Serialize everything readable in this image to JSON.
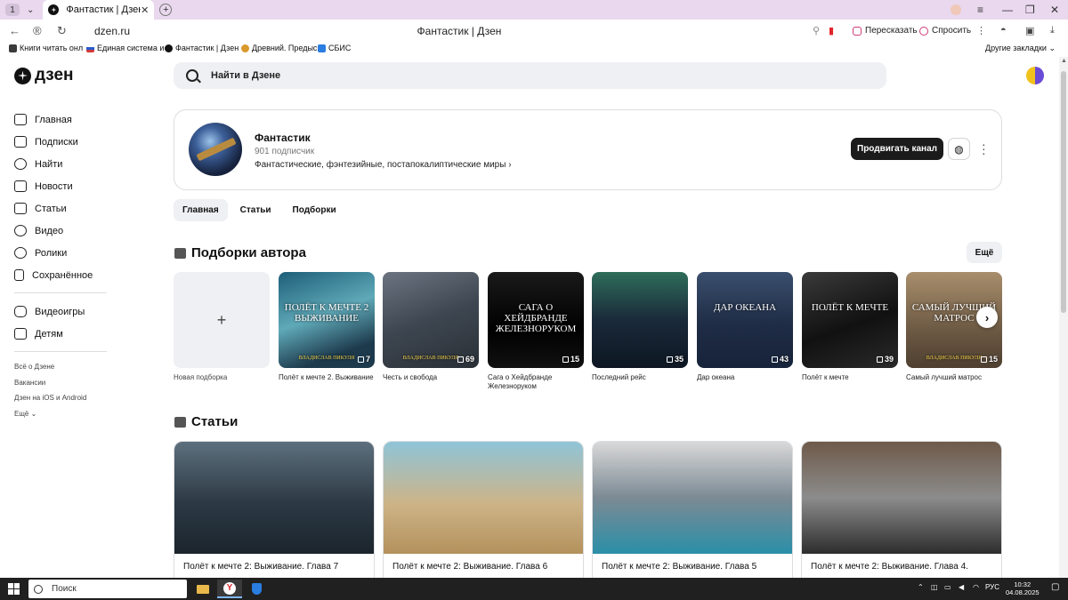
{
  "browser": {
    "tab_counter": "1",
    "tab_title": "Фантастик | Дзен",
    "url": "dzen.ru",
    "page_title": "Фантастик | Дзен",
    "retell_label": "Пересказать",
    "ask_label": "Спросить",
    "bookmarks": [
      {
        "label": "Книги читать онл",
        "color": "#3a3a3a"
      },
      {
        "label": "Единая система и",
        "color": "#d23a3a"
      },
      {
        "label": "Фантастик | Дзен",
        "color": "#111111"
      },
      {
        "label": "Древний. Предыс",
        "color": "#d99a2b"
      },
      {
        "label": "СБИС",
        "color": "#2a7de1"
      }
    ],
    "other_bookmarks": "Другие закладки"
  },
  "logo": {
    "text": "дзен"
  },
  "search": {
    "placeholder": "Найти в Дзене"
  },
  "sidebar": {
    "items": [
      {
        "label": "Главная",
        "icon": "home-icon"
      },
      {
        "label": "Подписки",
        "icon": "subscriptions-icon"
      },
      {
        "label": "Найти",
        "icon": "search-icon"
      },
      {
        "label": "Новости",
        "icon": "news-icon"
      },
      {
        "label": "Статьи",
        "icon": "articles-icon"
      },
      {
        "label": "Видео",
        "icon": "video-icon"
      },
      {
        "label": "Ролики",
        "icon": "shorts-icon"
      },
      {
        "label": "Сохранённое",
        "icon": "bookmark-icon"
      }
    ],
    "items2": [
      {
        "label": "Видеоигры",
        "icon": "gamepad-icon"
      },
      {
        "label": "Детям",
        "icon": "kids-icon"
      }
    ],
    "links": [
      "Всё о Дзене",
      "Вакансии",
      "Дзен на iOS и Android",
      "Ещё"
    ]
  },
  "channel": {
    "name": "Фантастик",
    "subscribers": "901 подписчик",
    "description": "Фантастические, фэнтезийные, постапокалиптические миры",
    "promote_label": "Продвигать канал"
  },
  "tabs": [
    "Главная",
    "Статьи",
    "Подборки"
  ],
  "collections": {
    "title": "Подборки автора",
    "more_label": "Ещё",
    "new_label": "Новая подборка",
    "items": [
      {
        "caption": "Полёт к мечте 2. Выживание",
        "count": "7",
        "overlay": "ПОЛЁТ К МЕЧТЕ 2 ВЫЖИВАНИЕ",
        "footer": "ВЛАДИСЛАВ ПИКУЛЯ",
        "bg": "linear-gradient(160deg,#1d5e78,#5fa9b8 45%,#1d3a4c 80%)"
      },
      {
        "caption": "Честь и свобода",
        "count": "69",
        "overlay": "",
        "footer": "ВЛАДИСЛАВ ПИКУЛЯ",
        "bg": "linear-gradient(160deg,#6b7480,#3d4650 50%,#2a2f36)"
      },
      {
        "caption": "Сага о Хейдбранде Железноруком",
        "count": "15",
        "overlay": "САГА О ХЕЙДБРАНДЕ ЖЕЛЕЗНОРУКОМ",
        "footer": "",
        "bg": "linear-gradient(180deg,#1a1a1a,#000 60%,#111)"
      },
      {
        "caption": "Последний рейс",
        "count": "35",
        "overlay": "",
        "footer": "",
        "bg": "linear-gradient(180deg,#2f6d5a,#1a2a3a 50%,#0d1622)"
      },
      {
        "caption": "Дар океана",
        "count": "43",
        "overlay": "ДАР ОКЕАНА",
        "footer": "",
        "bg": "linear-gradient(180deg,#3a4f6e,#1f2c45 55%,#16233a)"
      },
      {
        "caption": "Полёт к мечте",
        "count": "39",
        "overlay": "ПОЛЁТ К МЕЧТЕ",
        "footer": "",
        "bg": "linear-gradient(160deg,#3a3a3a,#111 55%,#2a2a2a)"
      },
      {
        "caption": "Самый лучший матрос",
        "count": "15",
        "overlay": "САМЫЙ ЛУЧШИЙ МАТРОС",
        "footer": "ВЛАДИСЛАВ ПИКУЛЯ",
        "bg": "linear-gradient(180deg,#a98e6c,#6d5a44 60%,#4e3f30)"
      }
    ]
  },
  "articles": {
    "title": "Статьи",
    "items": [
      {
        "title": "Полёт к мечте 2: Выживание. Глава 7",
        "bg": "linear-gradient(180deg,#5d6f7d,#2c3944 55%,#1b242c)"
      },
      {
        "title": "Полёт к мечте 2: Выживание. Глава 6",
        "bg": "linear-gradient(180deg,#8fc4d8,#cdb488 55%,#b4915c)"
      },
      {
        "title": "Полёт к мечте 2: Выживание. Глава 5",
        "bg": "linear-gradient(180deg,#d9d9d9,#7c8a94 50%,#2a8fa8)"
      },
      {
        "title": "Полёт к мечте 2: Выживание. Глава 4.",
        "bg": "linear-gradient(180deg,#6e5a4a,#8c8c8c 50%,#2d2d2d)"
      }
    ]
  },
  "taskbar": {
    "search_placeholder": "Поиск",
    "lang": "РУС",
    "time": "10:32",
    "date": "04.08.2025"
  }
}
